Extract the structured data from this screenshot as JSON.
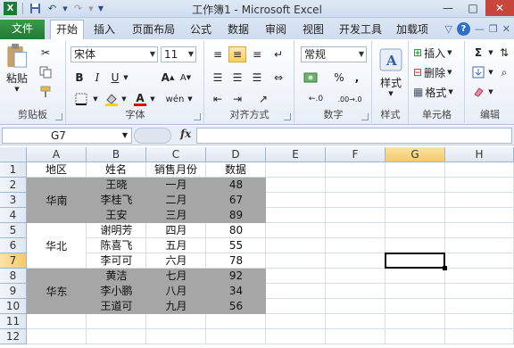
{
  "window": {
    "title": "工作簿1 - Microsoft Excel",
    "minimize": "—",
    "maximize": "□",
    "close": "✕"
  },
  "ribbon_tabs": {
    "file": "文件",
    "items": [
      "开始",
      "插入",
      "页面布局",
      "公式",
      "数据",
      "审阅",
      "视图",
      "开发工具",
      "加载项"
    ],
    "active": "开始"
  },
  "home": {
    "clipboard": {
      "paste": "粘贴",
      "label": "剪贴板"
    },
    "font": {
      "name": "宋体",
      "size": "11",
      "bold": "B",
      "italic": "I",
      "underline": "U",
      "label": "字体",
      "grow": "A",
      "shrink": "A"
    },
    "alignment": {
      "label": "对齐方式"
    },
    "number": {
      "format": "常规",
      "percent": "%",
      "comma": ",",
      "label": "数字",
      "inc": "←.0",
      "dec": ".00→.0"
    },
    "styles": {
      "label": "样式",
      "button": "样式"
    },
    "cells": {
      "insert": "插入",
      "delete": "删除",
      "format": "格式",
      "label": "单元格"
    },
    "editing": {
      "sum": "Σ",
      "label": "编辑"
    }
  },
  "formula_bar": {
    "name_box": "G7",
    "fx": "fx",
    "formula": ""
  },
  "colors": {
    "file_tab": "#2a8a3b",
    "shade": "#a6a6a6",
    "header_sel": "#f6c96a"
  },
  "sheet": {
    "columns": [
      "A",
      "B",
      "C",
      "D",
      "E",
      "F",
      "G",
      "H"
    ],
    "rows": [
      "1",
      "2",
      "3",
      "4",
      "5",
      "6",
      "7",
      "8",
      "9",
      "10",
      "11",
      "12"
    ],
    "selected_cell": "G7",
    "header": [
      "地区",
      "姓名",
      "销售月份",
      "数据"
    ],
    "regions": [
      "华南",
      "华北",
      "华东"
    ],
    "data": [
      [
        "王晓",
        "一月",
        "48"
      ],
      [
        "李桂飞",
        "二月",
        "67"
      ],
      [
        "王安",
        "三月",
        "89"
      ],
      [
        "谢明芳",
        "四月",
        "80"
      ],
      [
        "陈喜飞",
        "五月",
        "55"
      ],
      [
        "李可可",
        "六月",
        "78"
      ],
      [
        "黄洁",
        "七月",
        "92"
      ],
      [
        "李小鹏",
        "八月",
        "34"
      ],
      [
        "王道可",
        "九月",
        "56"
      ]
    ]
  }
}
